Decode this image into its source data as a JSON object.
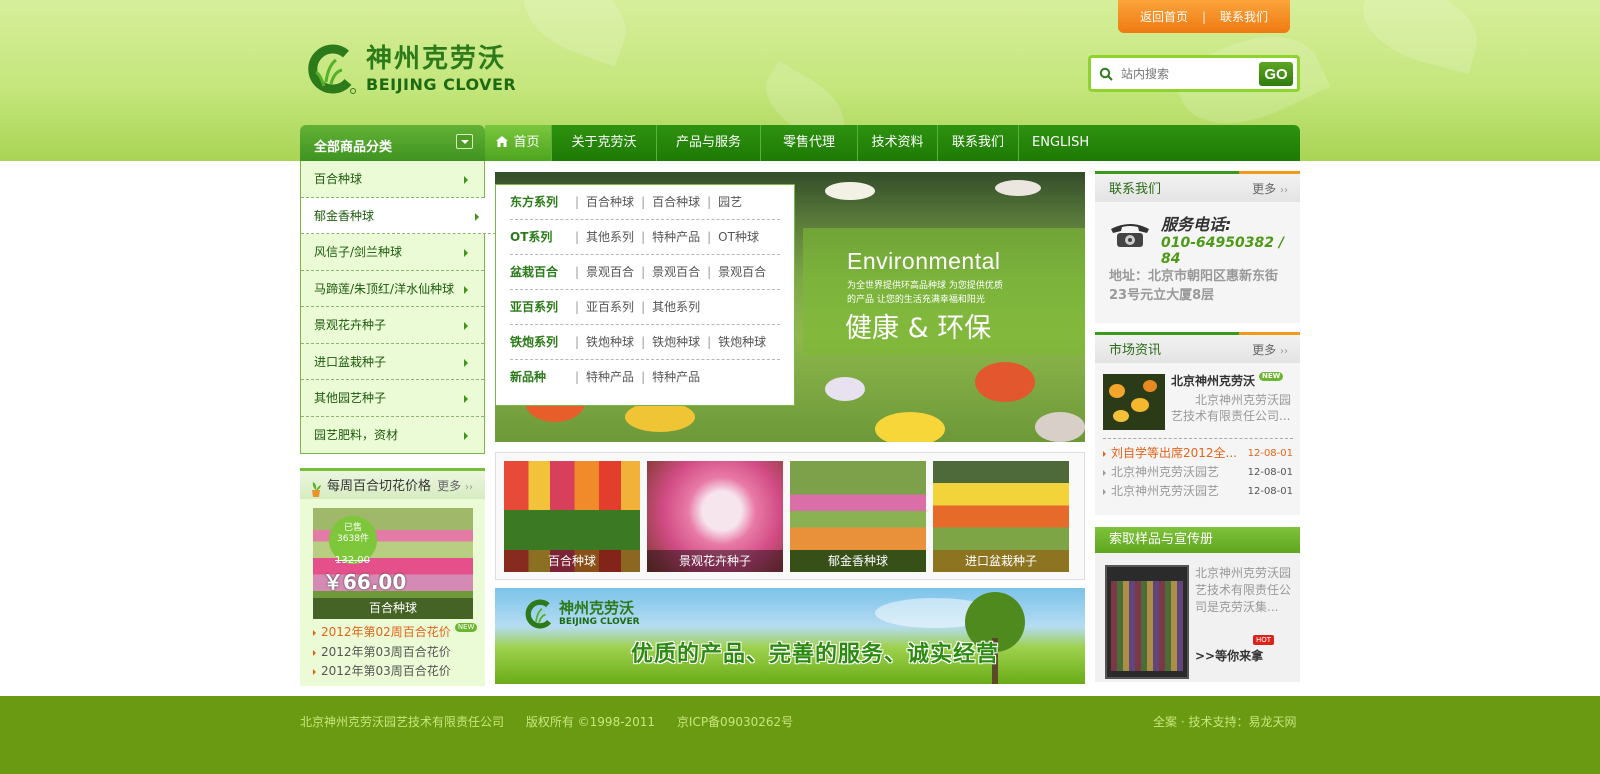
{
  "header": {
    "top_links": [
      "返回首页",
      "联系我们"
    ],
    "top_sep": "|",
    "logo_cn": "神州克劳沃",
    "logo_en": "BEIJING CLOVER",
    "search_placeholder": "站内搜索",
    "search_button": "GO"
  },
  "nav": {
    "category_title": "全部商品分类",
    "items": [
      "首页",
      "关于克劳沃",
      "产品与服务",
      "零售代理",
      "技术资料",
      "联系我们",
      "ENGLISH"
    ],
    "active": "首页"
  },
  "categories": [
    "百合种球",
    "郁金香种球",
    "风信子/剑兰种球",
    "马蹄莲/朱顶红/洋水仙种球",
    "景观花卉种子",
    "进口盆栽种子",
    "其他园艺种子",
    "园艺肥料，资材"
  ],
  "flyout": [
    {
      "key": "东方系列",
      "items": [
        "百合种球",
        "百合种球",
        "园艺"
      ]
    },
    {
      "key": "OT系列",
      "items": [
        "其他系列",
        "特种产品",
        "OT种球"
      ]
    },
    {
      "key": "盆栽百合",
      "items": [
        "景观百合",
        "景观百合",
        "景观百合"
      ]
    },
    {
      "key": "亚百系列",
      "items": [
        "亚百系列",
        "其他系列"
      ]
    },
    {
      "key": "铁炮系列",
      "items": [
        "铁炮种球",
        "铁炮种球",
        "铁炮种球"
      ]
    },
    {
      "key": "新品种",
      "items": [
        "特种产品",
        "特种产品"
      ]
    }
  ],
  "banner": {
    "en": "Environmental",
    "sub_lines": [
      "为全世界提供环高品种球 为您提供优质",
      "的产品 让您的生活充满幸福和阳光"
    ],
    "big": "健康 & 环保"
  },
  "thumbs": [
    "百合种球",
    "景观花卉种子",
    "郁金香种球",
    "进口盆栽种子"
  ],
  "banner2": {
    "logo_cn": "神州克劳沃",
    "logo_en": "BEIJING CLOVER",
    "slogan": "优质的产品、完善的服务、诚实经营"
  },
  "weekly": {
    "title": "每周百合切花价格",
    "more": "更多",
    "badge_top": "已售",
    "badge_count": "3638件",
    "old_price": "132.00",
    "price": "￥66.00",
    "caption": "百合种球",
    "list": [
      "2012年第02周百合花价",
      "2012年第03周百合花价",
      "2012年第03周百合花价"
    ],
    "new_tag": "NEW"
  },
  "contact": {
    "title": "联系我们",
    "more": "更多",
    "service": "服务电话:",
    "phone": "010-64950382 / 84",
    "address": "地址：北京市朝阳区惠新东街23号元立大厦8层"
  },
  "news": {
    "title": "市场资讯",
    "more": "更多",
    "feature_title": "北京神州克劳沃",
    "feature_desc": "北京神州克劳沃园艺技术有限责任公司...",
    "new_tag": "NEW",
    "list": [
      {
        "text": "刘自学等出席2012全...",
        "date": "12-08-01"
      },
      {
        "text": "北京神州克劳沃园艺",
        "date": "12-08-01"
      },
      {
        "text": "北京神州克劳沃园艺",
        "date": "12-08-01"
      }
    ]
  },
  "sample": {
    "title": "索取样品与宣传册",
    "desc": "北京神州克劳沃园艺技术有限责任公司是克劳沃集...",
    "wait": ">>等你来拿",
    "hot": "HOT"
  },
  "footer": {
    "company": "北京神州克劳沃园艺技术有限责任公司",
    "copyright": "版权所有 ©1998-2011",
    "icp": "京ICP备09030262号",
    "tech": "全案 · 技术支持：易龙天网"
  },
  "colors": {
    "brand_green": "#2c7a1a",
    "nav_green": "#1d7a04",
    "accent_orange": "#ef7a12",
    "footer_green": "#6a9a12"
  }
}
